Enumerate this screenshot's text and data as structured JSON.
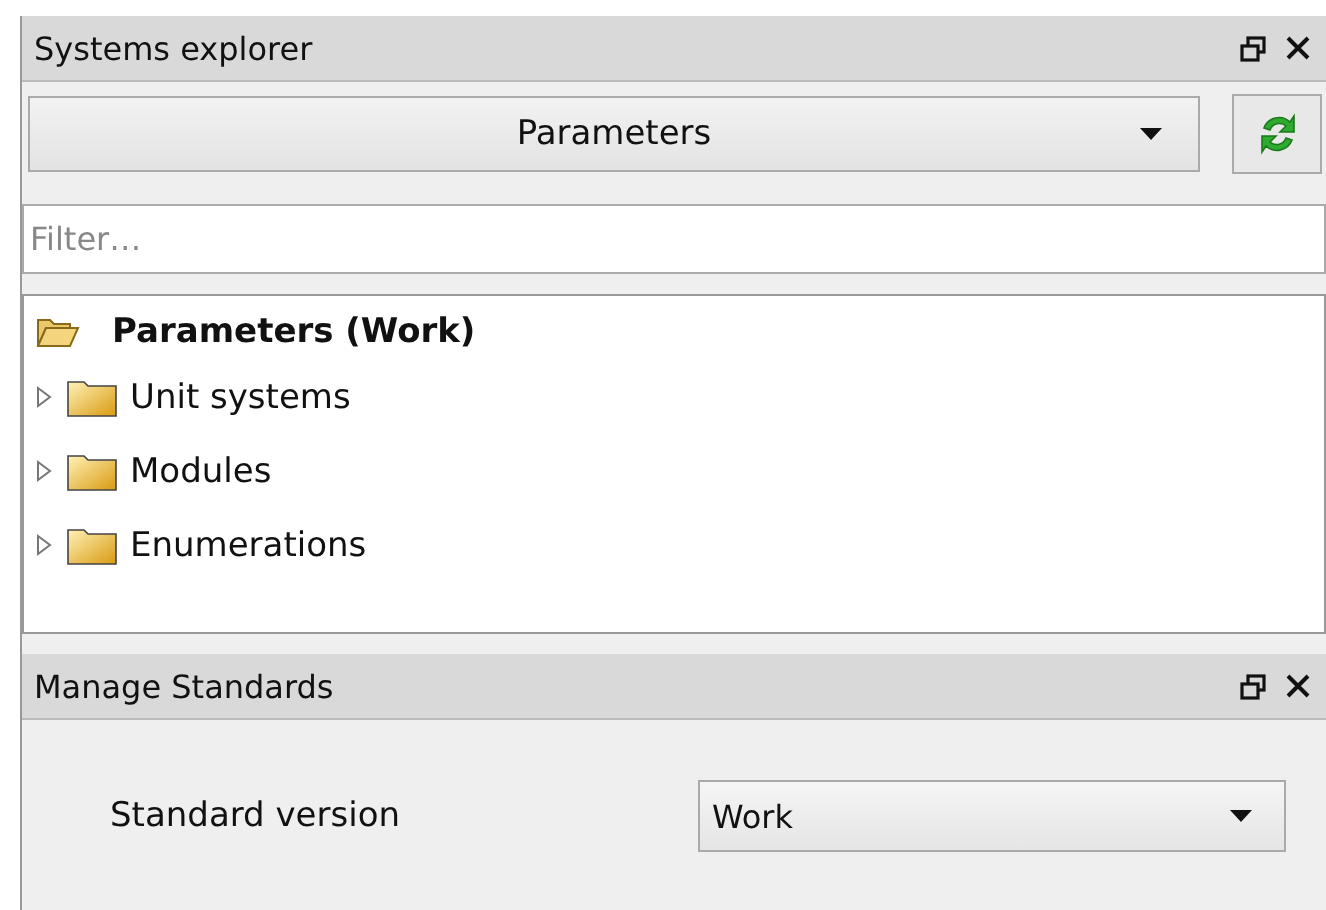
{
  "explorer": {
    "title": "Systems explorer",
    "selector": {
      "value": "Parameters"
    },
    "filter": {
      "placeholder": "Filter…"
    },
    "tree": [
      {
        "label": "Parameters (Work)",
        "expanded": true,
        "children": [
          {
            "label": "Unit systems",
            "expanded": false
          },
          {
            "label": "Modules",
            "expanded": false
          },
          {
            "label": "Enumerations",
            "expanded": false
          }
        ]
      }
    ]
  },
  "standards": {
    "title": "Manage Standards",
    "field_label": "Standard version",
    "version": {
      "value": "Work"
    }
  }
}
